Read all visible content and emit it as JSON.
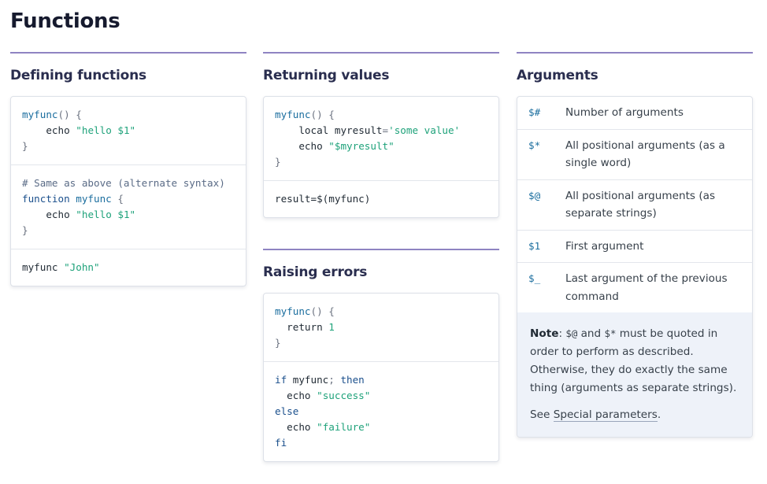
{
  "title": "Functions",
  "defining": {
    "title": "Defining functions",
    "block1": {
      "name": "myfunc",
      "paren": "() {",
      "echo": "echo",
      "str": "\"hello $1\"",
      "close": "}"
    },
    "block2": {
      "comment": "# Same as above (alternate syntax)",
      "kw": "function",
      "name": "myfunc",
      "brace": "{",
      "echo": "echo",
      "str": "\"hello $1\"",
      "close": "}"
    },
    "block3": {
      "cmd": "myfunc",
      "str": "\"John\""
    }
  },
  "returning": {
    "title": "Returning values",
    "block1": {
      "name": "myfunc",
      "paren": "() {",
      "local": "local",
      "var": "myresult",
      "eq": "=",
      "str": "'some value'",
      "echo": "echo",
      "str2": "\"$myresult\"",
      "close": "}"
    },
    "block2": {
      "text": "result=$(myfunc)"
    }
  },
  "raising": {
    "title": "Raising errors",
    "block1": {
      "name": "myfunc",
      "paren": "() {",
      "ret": "return",
      "num": "1",
      "close": "}"
    },
    "block2": {
      "if": "if",
      "cond": " myfunc",
      "semi": ";",
      "then": "then",
      "echo1": "echo",
      "str1": "\"success\"",
      "else": "else",
      "echo2": "echo",
      "str2": "\"failure\"",
      "fi": "fi"
    }
  },
  "arguments": {
    "title": "Arguments",
    "rows": [
      {
        "sym": "$#",
        "desc": "Number of arguments"
      },
      {
        "sym": "$*",
        "desc": "All positional arguments (as a single word)"
      },
      {
        "sym": "$@",
        "desc": "All positional arguments (as separate strings)"
      },
      {
        "sym": "$1",
        "desc": "First argument"
      },
      {
        "sym": "$_",
        "desc": "Last argument of the previous command"
      }
    ],
    "note": {
      "label": "Note",
      "colon": ":",
      "sym1": "$@",
      "and": " and ",
      "sym2": "$*",
      "text": " must be quoted in order to perform as described. Otherwise, they do exactly the same thing (arguments as separate strings).",
      "see": "See ",
      "link": "Special parameters",
      "period": "."
    }
  }
}
